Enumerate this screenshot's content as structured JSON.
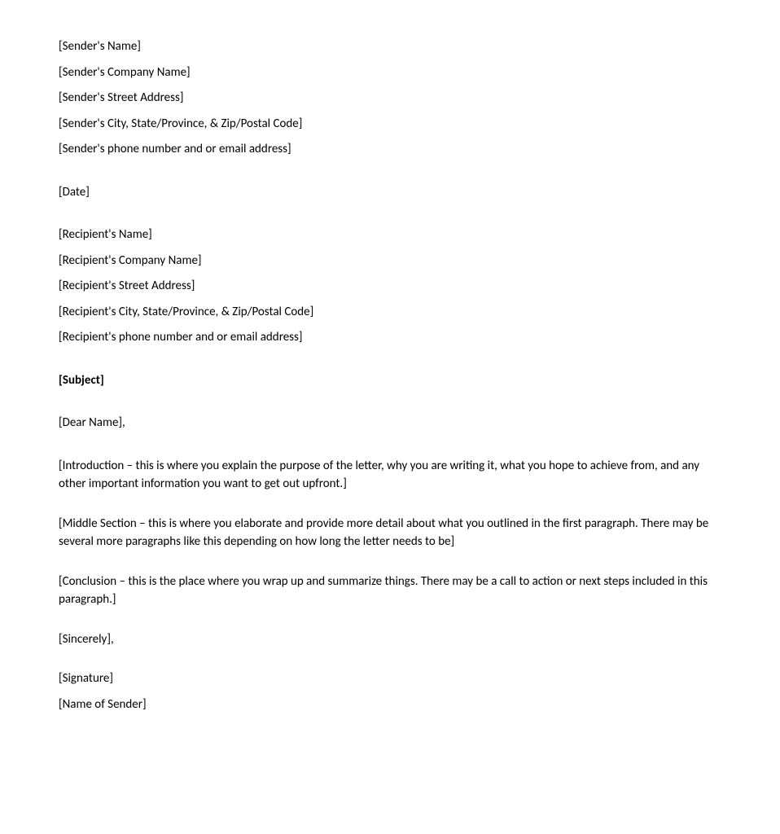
{
  "sender": {
    "name": "[Sender's Name]",
    "company": "[Sender's Company Name]",
    "street": "[Sender's Street Address]",
    "city_state_zip": "[Sender's City, State/Province, & Zip/Postal Code]",
    "contact": "[Sender's phone number and or email address]"
  },
  "date": "[Date]",
  "recipient": {
    "name": "[Recipient's Name]",
    "company": "[Recipient's Company Name]",
    "street": "[Recipient's Street Address]",
    "city_state_zip": "[Recipient's City, State/Province, & Zip/Postal Code]",
    "contact": "[Recipient's phone number and or email address]"
  },
  "subject": "[Subject]",
  "salutation": "[Dear Name],",
  "body": {
    "introduction": "[Introduction – this is where you explain the purpose of the letter, why you are writing it, what you hope to achieve from, and any other important information you want to get out upfront.]",
    "middle": "[Middle Section – this is where you elaborate and provide more detail about what you outlined in the first paragraph. There may be several more paragraphs like this depending on how long the letter needs to be]",
    "conclusion": "[Conclusion – this is the place where you wrap up and summarize things. There may be a call to action or next steps included in this paragraph.]"
  },
  "closing": "[Sincerely],",
  "signature": {
    "signature_placeholder": "[Signature]",
    "sender_name": "[Name of Sender]"
  }
}
